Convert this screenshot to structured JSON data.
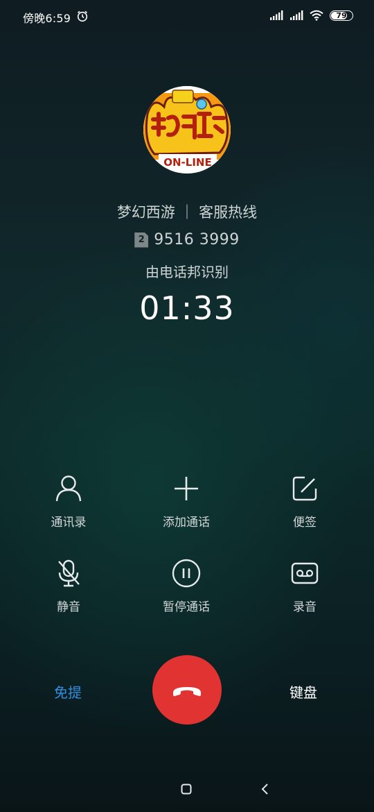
{
  "status_bar": {
    "time": "傍晚6:59",
    "battery": "79",
    "battery_level": 0.79
  },
  "contact": {
    "name": "梦幻西游 ｜ 客服热线",
    "sim": "2",
    "number": "9516 3999",
    "source": "由电话邦识别",
    "duration": "01:33",
    "avatar_logo_text": "梦幻西游 ON-LINE"
  },
  "actions": {
    "contacts": "通讯录",
    "add_call": "添加通话",
    "notes": "便签",
    "mute": "静音",
    "hold": "暂停通话",
    "record": "录音"
  },
  "bottom": {
    "speaker": "免提",
    "keypad": "键盘"
  },
  "colors": {
    "accent": "#2f8fe0",
    "hangup": "#e23333"
  }
}
